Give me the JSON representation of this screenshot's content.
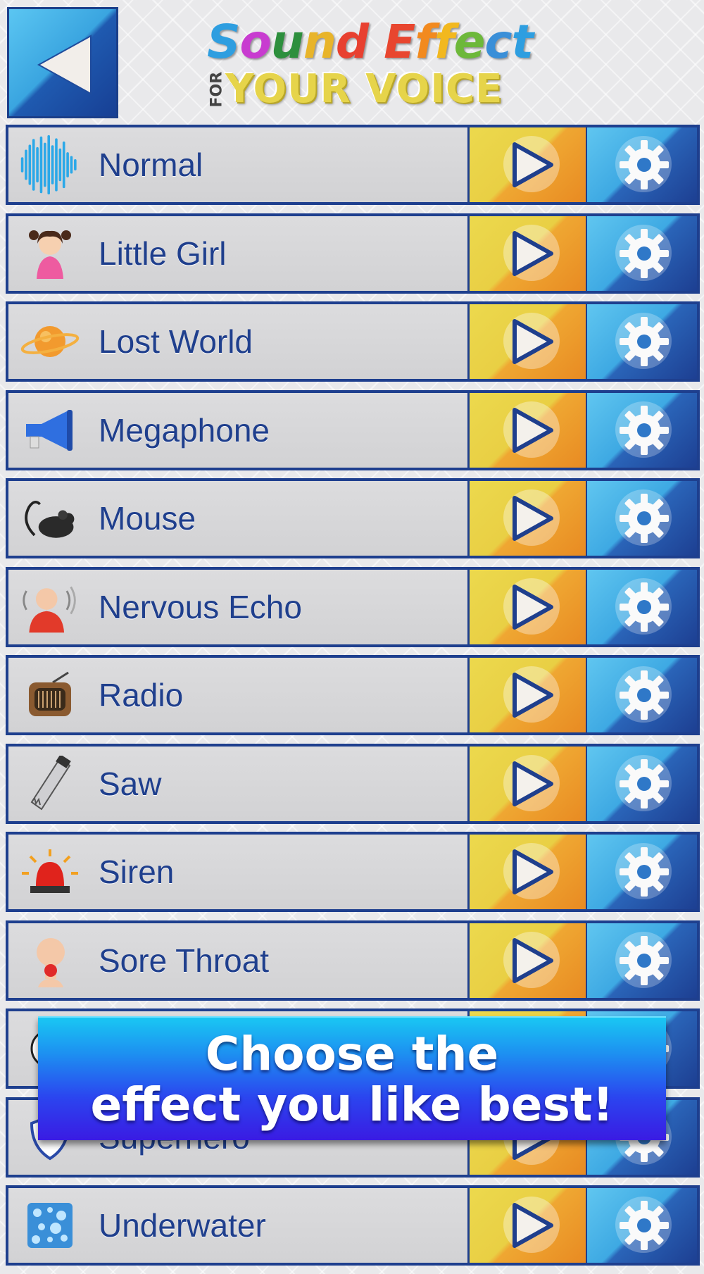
{
  "header": {
    "back_icon": "back-triangle-icon",
    "logo": {
      "line1_words": [
        {
          "text": "Sound",
          "colors": [
            "#2e9ee0",
            "#c83cd0",
            "#2d8f3d",
            "#e8b42a",
            "#e84030"
          ]
        },
        {
          "text": "Effect",
          "colors": [
            "#e8462f",
            "#f28a1f",
            "#f2b81f",
            "#6db83a",
            "#3a8fd8",
            "#2e9ee0"
          ]
        }
      ],
      "line1_text": "Sound Effect",
      "for_text": "FOR",
      "line2_text": "YOUR VOICE"
    }
  },
  "effects": [
    {
      "label": "Normal",
      "icon": "sound-wave-icon"
    },
    {
      "label": "Little Girl",
      "icon": "little-girl-icon"
    },
    {
      "label": "Lost World",
      "icon": "planet-icon"
    },
    {
      "label": "Megaphone",
      "icon": "megaphone-icon"
    },
    {
      "label": "Mouse",
      "icon": "mouse-icon"
    },
    {
      "label": "Nervous Echo",
      "icon": "nervous-man-icon"
    },
    {
      "label": "Radio",
      "icon": "radio-icon"
    },
    {
      "label": "Saw",
      "icon": "saw-icon"
    },
    {
      "label": "Siren",
      "icon": "siren-icon"
    },
    {
      "label": "Sore Throat",
      "icon": "sore-throat-icon"
    },
    {
      "label": "",
      "icon": "ball-icon"
    },
    {
      "label": "Superhero",
      "icon": "superhero-shield-icon"
    },
    {
      "label": "Underwater",
      "icon": "water-bubbles-icon"
    }
  ],
  "row_buttons": {
    "play_icon": "play-icon",
    "settings_icon": "gear-icon"
  },
  "banner": {
    "text": "Choose the\neffect you like best!"
  },
  "colors": {
    "accent_blue": "#1e3f8e",
    "play_yellow": "#ecd94d",
    "play_orange": "#e88a22",
    "gear_blue": "#3ea9e3"
  }
}
